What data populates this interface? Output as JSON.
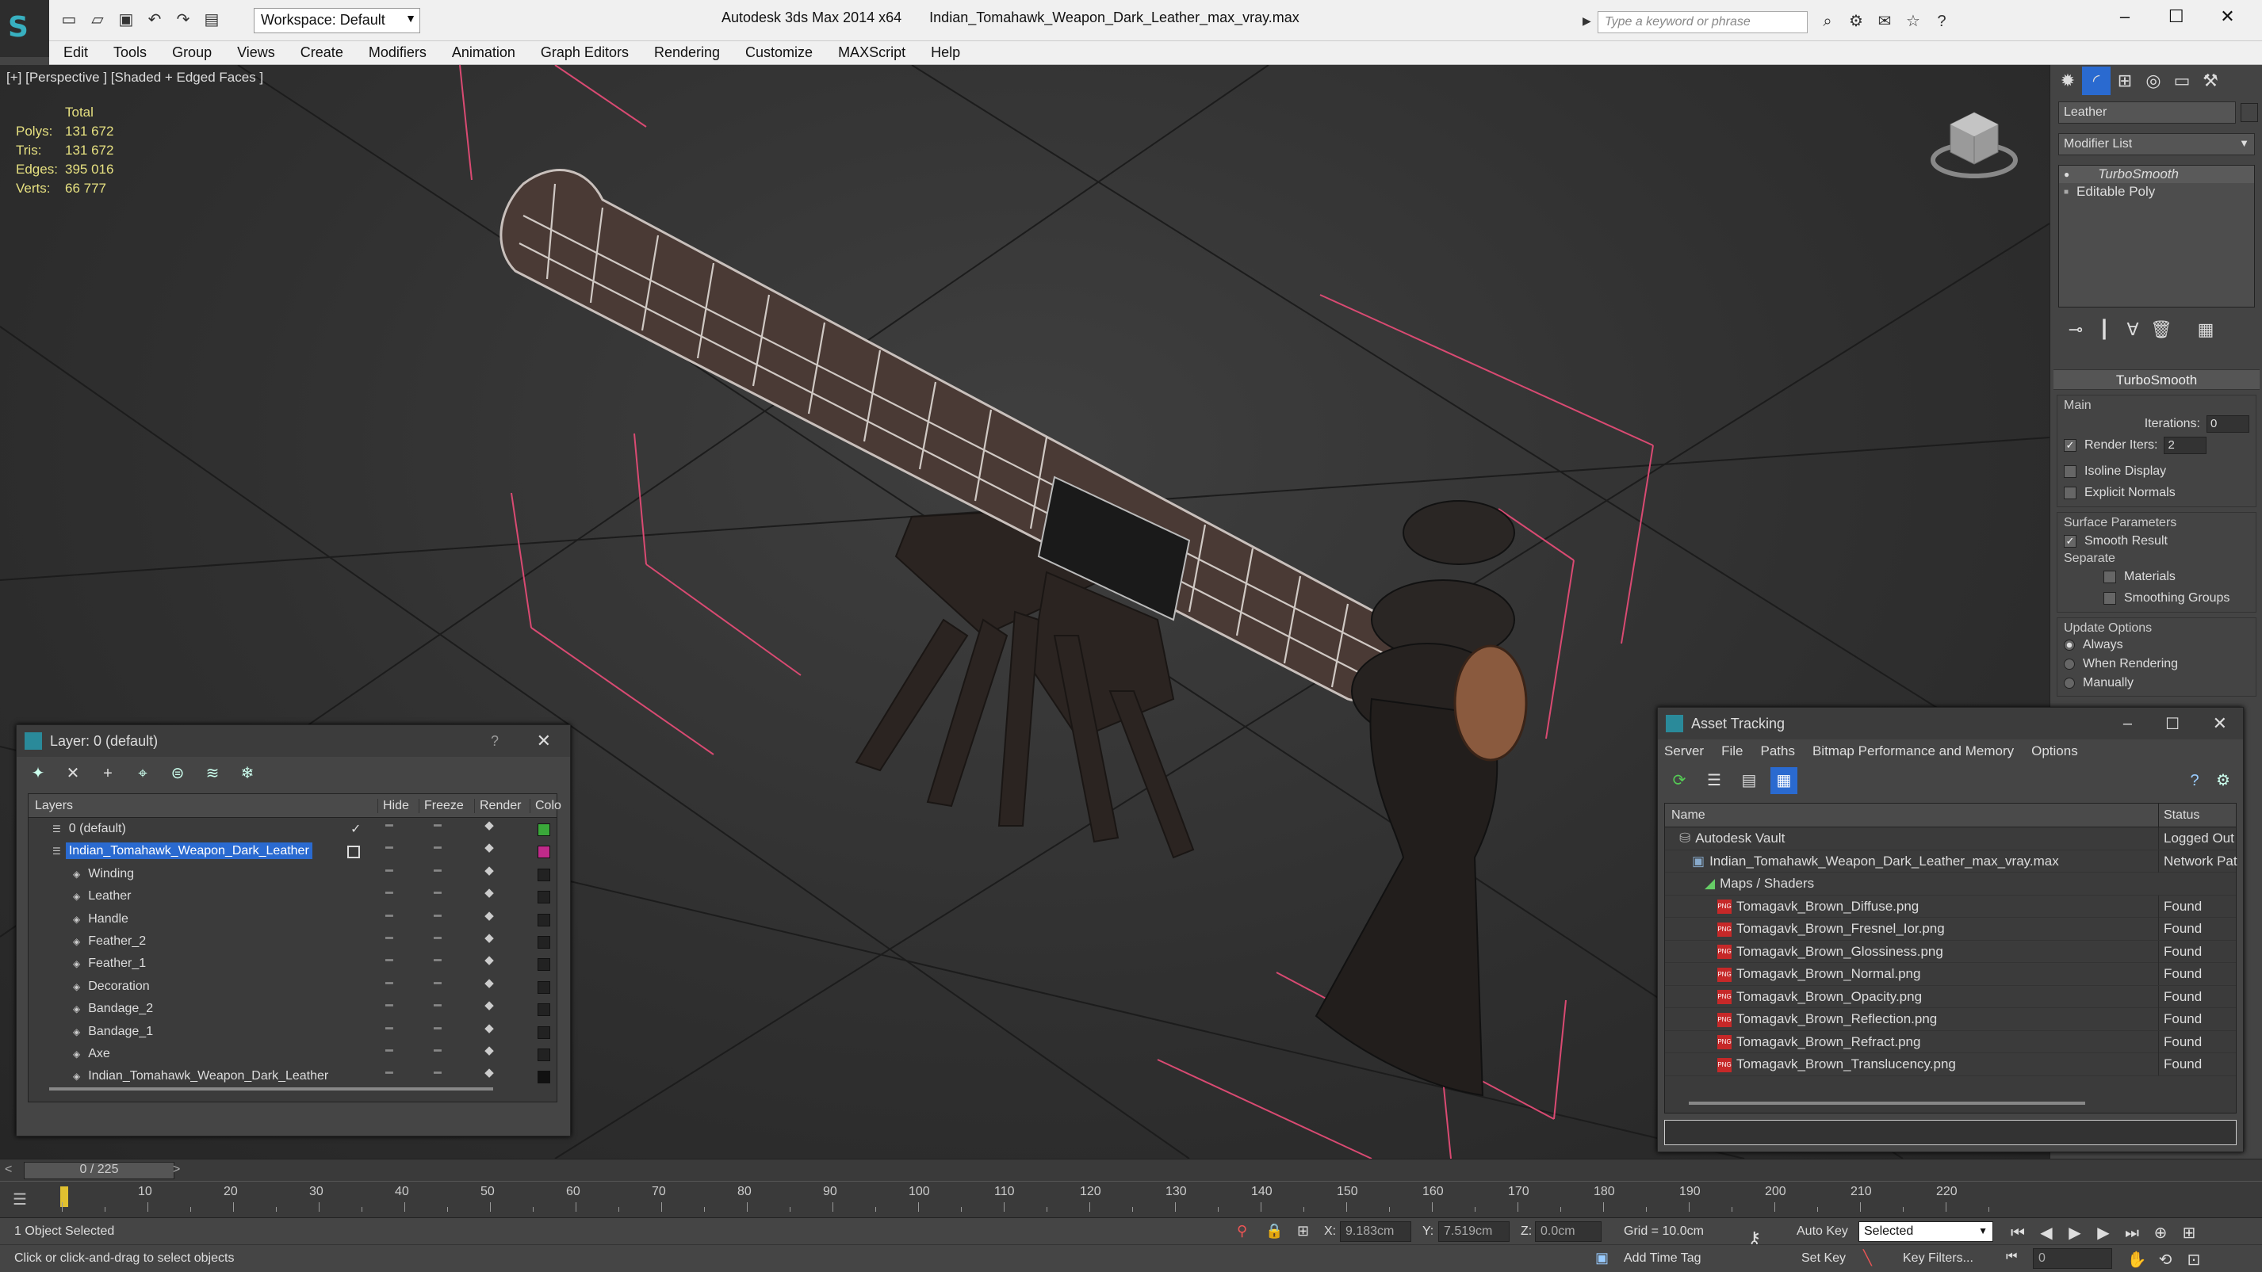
{
  "app": {
    "title": "Autodesk 3ds Max  2014 x64",
    "filename": "Indian_Tomahawk_Weapon_Dark_Leather_max_vray.max",
    "workspace": "Workspace: Default",
    "search_placeholder": "Type a keyword or phrase"
  },
  "menu": [
    "Edit",
    "Tools",
    "Group",
    "Views",
    "Create",
    "Modifiers",
    "Animation",
    "Graph Editors",
    "Rendering",
    "Customize",
    "MAXScript",
    "Help"
  ],
  "viewport": {
    "label": "[+] [Perspective ] [Shaded + Edged Faces ]",
    "stats_header": "Total",
    "stats": [
      {
        "key": "Polys:",
        "value": "131 672"
      },
      {
        "key": "Tris:",
        "value": "131 672"
      },
      {
        "key": "Edges:",
        "value": "395 016"
      },
      {
        "key": "Verts:",
        "value": "66 777"
      }
    ]
  },
  "command_panel": {
    "object_name": "Leather",
    "modifier_list": "Modifier List",
    "stack": [
      "TurboSmooth",
      "Editable Poly"
    ],
    "rollout": "TurboSmooth",
    "main_label": "Main",
    "iterations_label": "Iterations:",
    "iterations": "0",
    "render_iters_label": "Render Iters:",
    "render_iters": "2",
    "isoline": "Isoline Display",
    "explicit_normals": "Explicit Normals",
    "surface_params": "Surface Parameters",
    "smooth_result": "Smooth Result",
    "separate": "Separate",
    "materials": "Materials",
    "smoothing_groups": "Smoothing Groups",
    "update_options": "Update Options",
    "always": "Always",
    "when_rendering": "When Rendering",
    "manually": "Manually"
  },
  "layer_dialog": {
    "title": "Layer: 0 (default)",
    "help": "?",
    "columns": [
      "Layers",
      "Hide",
      "Freeze",
      "Render",
      "Colo"
    ],
    "rows": [
      {
        "name": "0 (default)",
        "indent": 0,
        "color": "#3aa83a",
        "current": true
      },
      {
        "name": "Indian_Tomahawk_Weapon_Dark_Leather",
        "indent": 0,
        "color": "#c02a8a",
        "selected": true
      },
      {
        "name": "Winding",
        "indent": 1,
        "color": "#222222"
      },
      {
        "name": "Leather",
        "indent": 1,
        "color": "#222222"
      },
      {
        "name": "Handle",
        "indent": 1,
        "color": "#222222"
      },
      {
        "name": "Feather_2",
        "indent": 1,
        "color": "#222222"
      },
      {
        "name": "Feather_1",
        "indent": 1,
        "color": "#222222"
      },
      {
        "name": "Decoration",
        "indent": 1,
        "color": "#222222"
      },
      {
        "name": "Bandage_2",
        "indent": 1,
        "color": "#222222"
      },
      {
        "name": "Bandage_1",
        "indent": 1,
        "color": "#222222"
      },
      {
        "name": "Axe",
        "indent": 1,
        "color": "#222222"
      },
      {
        "name": "Indian_Tomahawk_Weapon_Dark_Leather",
        "indent": 1,
        "color": "#111111"
      }
    ]
  },
  "asset_dialog": {
    "title": "Asset Tracking",
    "menu": [
      "Server",
      "File",
      "Paths",
      "Bitmap Performance and Memory",
      "Options"
    ],
    "columns": [
      "Name",
      "Status"
    ],
    "rows": [
      {
        "name": "Autodesk Vault",
        "indent": 0,
        "status": "Logged Out ..."
      },
      {
        "name": "Indian_Tomahawk_Weapon_Dark_Leather_max_vray.max",
        "indent": 1,
        "status": "Network Path"
      },
      {
        "name": "Maps / Shaders",
        "indent": 2,
        "status": ""
      },
      {
        "name": "Tomagavk_Brown_Diffuse.png",
        "indent": 3,
        "status": "Found"
      },
      {
        "name": "Tomagavk_Brown_Fresnel_Ior.png",
        "indent": 3,
        "status": "Found"
      },
      {
        "name": "Tomagavk_Brown_Glossiness.png",
        "indent": 3,
        "status": "Found"
      },
      {
        "name": "Tomagavk_Brown_Normal.png",
        "indent": 3,
        "status": "Found"
      },
      {
        "name": "Tomagavk_Brown_Opacity.png",
        "indent": 3,
        "status": "Found"
      },
      {
        "name": "Tomagavk_Brown_Reflection.png",
        "indent": 3,
        "status": "Found"
      },
      {
        "name": "Tomagavk_Brown_Refract.png",
        "indent": 3,
        "status": "Found"
      },
      {
        "name": "Tomagavk_Brown_Translucency.png",
        "indent": 3,
        "status": "Found"
      }
    ]
  },
  "timeline": {
    "frame": "0 / 225",
    "ticks": [
      "10",
      "20",
      "30",
      "40",
      "50",
      "60",
      "70",
      "80",
      "90",
      "100",
      "110",
      "120",
      "130",
      "140",
      "150",
      "160",
      "170",
      "180",
      "190",
      "200",
      "210",
      "220"
    ]
  },
  "status": {
    "selection": "1 Object Selected",
    "prompt": "Click or click-and-drag to select objects",
    "x_label": "X:",
    "x": "9.183cm",
    "y_label": "Y:",
    "y": "7.519cm",
    "z_label": "Z:",
    "z": "0.0cm",
    "grid": "Grid = 10.0cm",
    "auto_key": "Auto Key",
    "set_key": "Set Key",
    "selected": "Selected",
    "key_filters": "Key Filters...",
    "add_time_tag": "Add Time Tag",
    "frame_field": "0"
  }
}
